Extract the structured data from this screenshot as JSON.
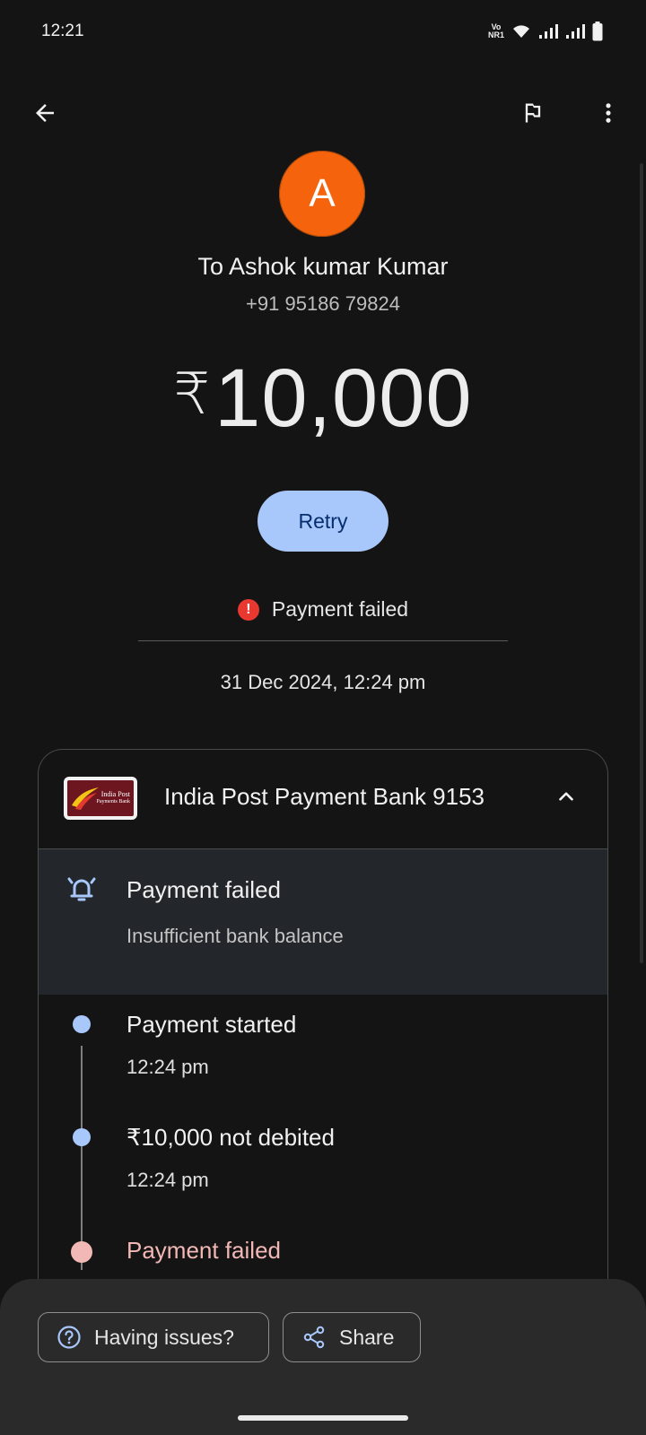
{
  "status_bar": {
    "time": "12:21",
    "volte_top": "Vo",
    "volte_bottom": "NR1"
  },
  "top_bar": {
    "back_icon": "arrow-left-icon",
    "report_icon": "flag-icon",
    "menu_icon": "more-vert-icon"
  },
  "recipient": {
    "avatar_letter": "A",
    "avatar_color": "#f5630c",
    "to_label": "To Ashok kumar Kumar",
    "phone": "+91 95186 79824"
  },
  "amount": {
    "currency": "₹",
    "value": "10,000"
  },
  "retry_label": "Retry",
  "payment_status": {
    "icon": "!",
    "text": "Payment failed",
    "date": "31 Dec 2024, 12:24 pm"
  },
  "card": {
    "bank_logo_text_line1": "India Post",
    "bank_logo_text_line2": "Payments Bank",
    "bank_name": "India Post Payment Bank 9153",
    "alert_title": "Payment failed",
    "alert_subtitle": "Insufficient bank balance",
    "timeline": [
      {
        "title": "Payment started",
        "time": "12:24 pm"
      },
      {
        "title": "₹10,000 not debited",
        "time": "12:24 pm"
      },
      {
        "title": "Payment failed"
      }
    ]
  },
  "bottom_sheet": {
    "help_label": "Having issues?",
    "share_label": "Share"
  },
  "colors": {
    "accent": "#a8c7fa",
    "error": "#e8382f",
    "background": "#141414"
  }
}
